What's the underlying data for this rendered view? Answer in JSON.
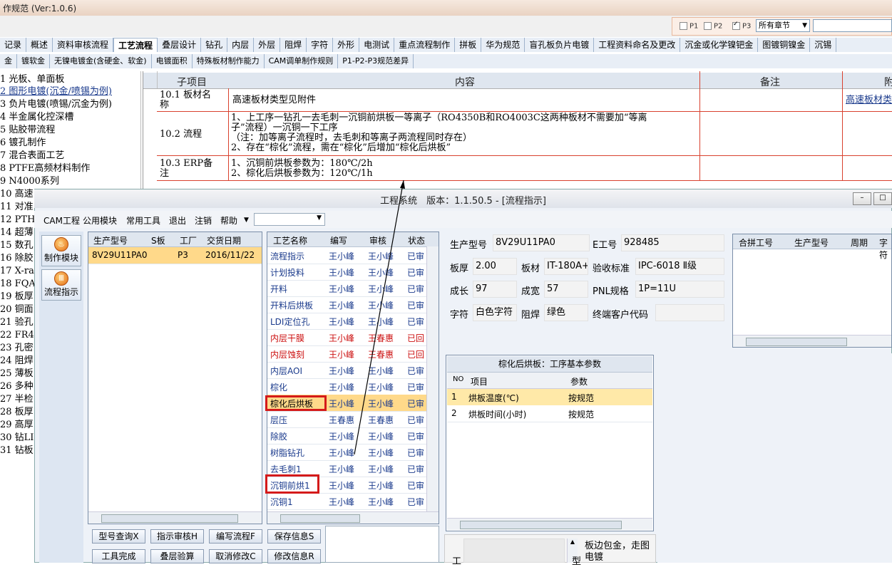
{
  "back_window": {
    "title": "作规范 (Ver:1.0.6)",
    "checkboxes": [
      {
        "label": "P1",
        "checked": false
      },
      {
        "label": "P2",
        "checked": false
      },
      {
        "label": "P3",
        "checked": true
      }
    ],
    "chapter_select": "所有章节",
    "tabs_row1": [
      "记录",
      "概述",
      "资料审核流程",
      "工艺流程",
      "叠层设计",
      "钻孔",
      "内层",
      "外层",
      "阻焊",
      "字符",
      "外形",
      "电测试",
      "重点流程制作",
      "拼板",
      "华为规范",
      "盲孔板负片电镀",
      "工程资料命名及更改",
      "沉金或化学镍钯金",
      "图镀铜镍金",
      "沉锡"
    ],
    "active_tab": "工艺流程",
    "tabs_row2": [
      "金",
      "镀软金",
      "无镍电镀金(含硬金、软金)",
      "电镀面积",
      "特殊板材制作能力",
      "CAM调单制作规则",
      "P1-P2-P3规范差异"
    ],
    "outline": [
      "1 光板、单面板",
      "2 图形电镀(沉金/喷锡为例)",
      "3 负片电镀(喷锡/沉金为例)",
      "4 半金属化控深槽",
      "5 贴胶带流程",
      "6 镀孔制作",
      "7 混合表面工艺",
      "8 PTFE高频材料制作",
      "9 N4000系列",
      "10 高速",
      "11 对准",
      "12 PTH",
      "14 超薄",
      "15 数孔",
      "16 除胶",
      "17 X-ra",
      "18 FQA",
      "19 板厚",
      "20 铜面",
      "21 验孔",
      "22 FR4",
      "23 孔密",
      "24 阻焊",
      "25 薄板",
      "26 多种",
      "27 半检",
      "28 板厚",
      "29 高厚",
      "30 钻LI",
      "31 钻板"
    ],
    "outline_selected": 1,
    "doc_table": {
      "headers": [
        "子项目",
        "内容",
        "备注",
        "附"
      ],
      "rows": [
        {
          "item": "10.1 板材名\n称",
          "content": "高速板材类型见附件",
          "note": "",
          "attach": "高速板材类"
        },
        {
          "item": "10.2 流程",
          "content": "1、上工序一钻孔一去毛刺一沉铜前烘板一等离子（RO4350B和RO4003C这两种板材不需要加“等离\n子”流程）一沉铜一下工序\n（注：加等离子流程时，去毛刺和等离子两流程同时存在）\n2、存在“棕化”流程，需在“棕化”后增加“棕化后烘板”",
          "note": "",
          "attach": ""
        },
        {
          "item": "10.3 ERP备\n注",
          "content": "1、沉铜前烘板参数为：180℃/2h\n2、棕化后烘板参数为：120℃/1h",
          "note": "",
          "attach": ""
        }
      ]
    }
  },
  "front_window": {
    "title": "工程系统　版本：1.1.50.5 - [流程指示]",
    "menu": [
      "CAM工程",
      "公用模块",
      "常用工具",
      "退出",
      "注销",
      "帮助"
    ],
    "nav": [
      {
        "label": "制作模块"
      },
      {
        "label": "流程指示"
      }
    ],
    "orders_grid": {
      "headers": [
        "生产型号",
        "S板",
        "工厂",
        "交货日期"
      ],
      "rows": [
        {
          "model": "8V29U11PA0",
          "s": "",
          "factory": "P3",
          "date": "2016/11/22"
        }
      ]
    },
    "process_grid": {
      "headers": [
        "工艺名称",
        "编写",
        "审核",
        "状态"
      ],
      "rows": [
        {
          "name": "流程指示",
          "writer": "王小峰",
          "reviewer": "王小峰",
          "status": "已审",
          "color": "blue"
        },
        {
          "name": "计划投料",
          "writer": "王小峰",
          "reviewer": "王小峰",
          "status": "已审",
          "color": "blue"
        },
        {
          "name": "开料",
          "writer": "王小峰",
          "reviewer": "王小峰",
          "status": "已审",
          "color": "blue"
        },
        {
          "name": "开料后烘板",
          "writer": "王小峰",
          "reviewer": "王小峰",
          "status": "已审",
          "color": "blue"
        },
        {
          "name": "LDI定位孔",
          "writer": "王小峰",
          "reviewer": "王小峰",
          "status": "已审",
          "color": "blue"
        },
        {
          "name": "内层干膜",
          "writer": "王小峰",
          "reviewer": "王春惠",
          "status": "已回",
          "color": "red"
        },
        {
          "name": "内层蚀刻",
          "writer": "王小峰",
          "reviewer": "王春惠",
          "status": "已回",
          "color": "red"
        },
        {
          "name": "内层AOI",
          "writer": "王小峰",
          "reviewer": "王小峰",
          "status": "已审",
          "color": "blue"
        },
        {
          "name": "棕化",
          "writer": "王小峰",
          "reviewer": "王小峰",
          "status": "已审",
          "color": "blue"
        },
        {
          "name": "棕化后烘板",
          "writer": "王小峰",
          "reviewer": "王小峰",
          "status": "已审",
          "color": "blue"
        },
        {
          "name": "层压",
          "writer": "王春惠",
          "reviewer": "王春惠",
          "status": "已审",
          "color": "blue"
        },
        {
          "name": "除胶",
          "writer": "王小峰",
          "reviewer": "王小峰",
          "status": "已审",
          "color": "blue"
        },
        {
          "name": "树脂钻孔",
          "writer": "王小峰",
          "reviewer": "王小峰",
          "status": "已审",
          "color": "blue"
        },
        {
          "name": "去毛刺1",
          "writer": "王小峰",
          "reviewer": "王小峰",
          "status": "已审",
          "color": "blue"
        },
        {
          "name": "沉铜前烘1",
          "writer": "王小峰",
          "reviewer": "王小峰",
          "status": "已审",
          "color": "blue"
        },
        {
          "name": "沉铜1",
          "writer": "王小峰",
          "reviewer": "王小峰",
          "status": "已审",
          "color": "blue"
        }
      ],
      "selected_row": 9
    },
    "info": {
      "model_label": "生产型号",
      "model": "8V29U11PA0",
      "e_label": "E工号",
      "e": "928485",
      "thick_label": "板厚",
      "thick": "2.00",
      "material_label": "板材",
      "material": "IT-180A+",
      "std_label": "验收标准",
      "std": "IPC-6018 Ⅱ级",
      "len_label": "成长",
      "len": "97",
      "wid_label": "成宽",
      "wid": "57",
      "pnl_label": "PNL规格",
      "pnl": "1P=11U",
      "char_label": "字符",
      "char": "白色字符",
      "mask_label": "阻焊",
      "mask": "绿色",
      "client_label": "终端客户代码",
      "client": ""
    },
    "combine_grid": {
      "headers": [
        "合拼工号",
        "生产型号",
        "周期",
        "字符"
      ]
    },
    "params": {
      "title": "棕化后烘板：工序基本参数",
      "headers": [
        "NO",
        "项目",
        "参数"
      ],
      "rows": [
        {
          "no": "1",
          "item": "烘板温度(℃)",
          "value": "按规范"
        },
        {
          "no": "2",
          "item": "烘板时间(小时)",
          "value": "按规范"
        }
      ]
    },
    "buttons_row1": [
      "型号查询X",
      "指示审核H",
      "编写流程F",
      "保存信息S"
    ],
    "buttons_row2": [
      "工具完成",
      "叠层验算",
      "取消修改C",
      "修改信息R"
    ],
    "bottom_left_label": "工",
    "bottom_mid_label": "型",
    "bottom_right_text": "板边包金，走图\n电镀"
  }
}
